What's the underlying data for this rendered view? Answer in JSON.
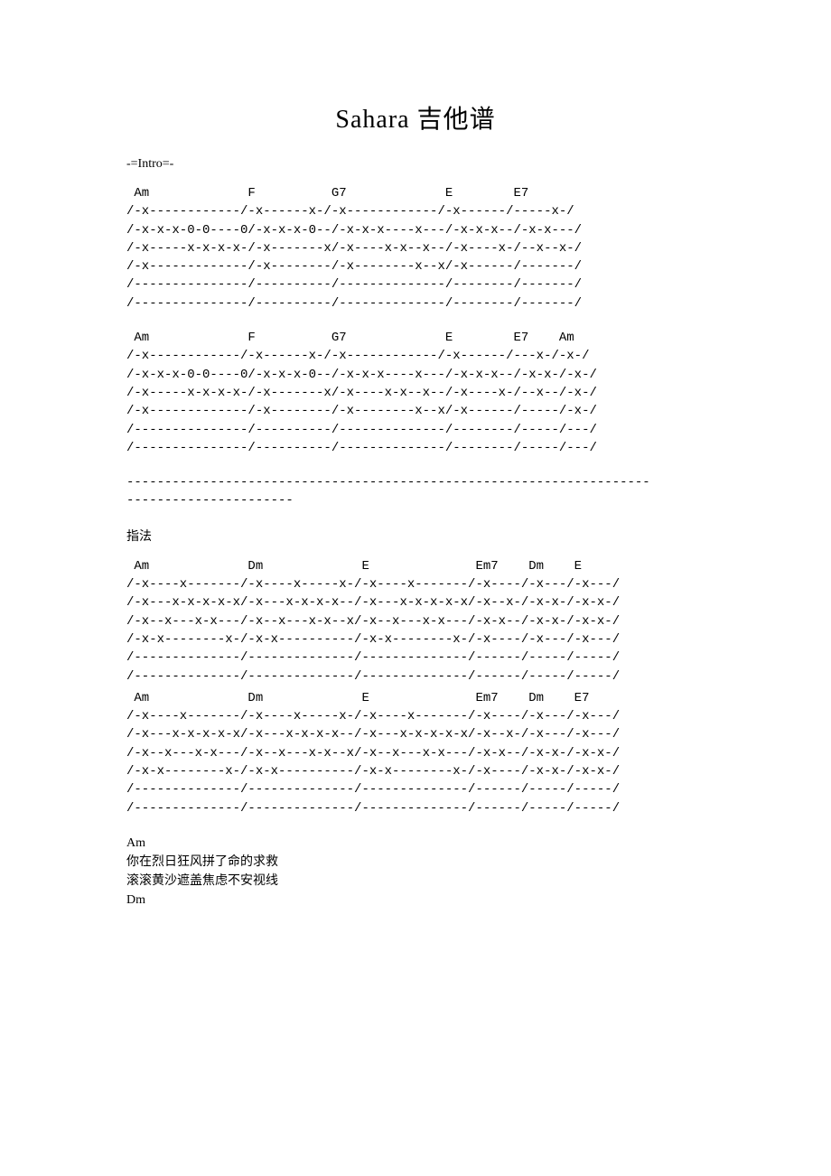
{
  "title": "Sahara 吉他谱",
  "intro_label": "-=Intro=-",
  "tab1_chords": " Am             F          G7             E        E7",
  "tab1_lines": [
    "/-x------------/-x------x-/-x------------/-x------/-----x-/",
    "/-x-x-x-0-0----0/-x-x-x-0--/-x-x-x----x---/-x-x-x--/-x-x---/",
    "/-x-----x-x-x-x-/-x-------x/-x----x-x--x--/-x----x-/--x--x-/",
    "/-x-------------/-x--------/-x--------x--x/-x------/-------/",
    "/---------------/----------/--------------/--------/-------/",
    "/---------------/----------/--------------/--------/-------/"
  ],
  "tab2_chords": " Am             F          G7             E        E7    Am",
  "tab2_lines": [
    "/-x------------/-x------x-/-x------------/-x------/---x-/-x-/",
    "/-x-x-x-0-0----0/-x-x-x-0--/-x-x-x----x---/-x-x-x--/-x-x-/-x-/",
    "/-x-----x-x-x-x-/-x-------x/-x----x-x--x--/-x----x-/--x--/-x-/",
    "/-x-------------/-x--------/-x--------x--x/-x------/-----/-x-/",
    "/---------------/----------/--------------/--------/-----/---/",
    "/---------------/----------/--------------/--------/-----/---/"
  ],
  "divider1": "---------------------------------------------------------------------",
  "divider2": "----------------------",
  "fingering_label": "指法",
  "tab3_chords": " Am             Dm             E              Em7    Dm    E",
  "tab3_lines": [
    "/-x----x-------/-x----x-----x-/-x----x-------/-x----/-x---/-x---/",
    "/-x---x-x-x-x-x/-x---x-x-x-x--/-x---x-x-x-x-x/-x--x-/-x-x-/-x-x-/",
    "/-x--x---x-x---/-x--x---x-x--x/-x--x---x-x---/-x-x--/-x-x-/-x-x-/",
    "/-x-x--------x-/-x-x----------/-x-x--------x-/-x----/-x---/-x---/",
    "/--------------/--------------/--------------/------/-----/-----/",
    "/--------------/--------------/--------------/------/-----/-----/"
  ],
  "tab4_chords": " Am             Dm             E              Em7    Dm    E7",
  "tab4_lines": [
    "/-x----x-------/-x----x-----x-/-x----x-------/-x----/-x---/-x---/",
    "/-x---x-x-x-x-x/-x---x-x-x-x--/-x---x-x-x-x-x/-x--x-/-x---/-x---/",
    "/-x--x---x-x---/-x--x---x-x--x/-x--x---x-x---/-x-x--/-x-x-/-x-x-/",
    "/-x-x--------x-/-x-x----------/-x-x--------x-/-x----/-x-x-/-x-x-/",
    "/--------------/--------------/--------------/------/-----/-----/",
    "/--------------/--------------/--------------/------/-----/-----/"
  ],
  "lyrics": {
    "chord1": "Am",
    "line1": "你在烈日狂风拼了命的求救",
    "line2": "滚滚黄沙遮盖焦虑不安视线",
    "chord2": "Dm"
  }
}
